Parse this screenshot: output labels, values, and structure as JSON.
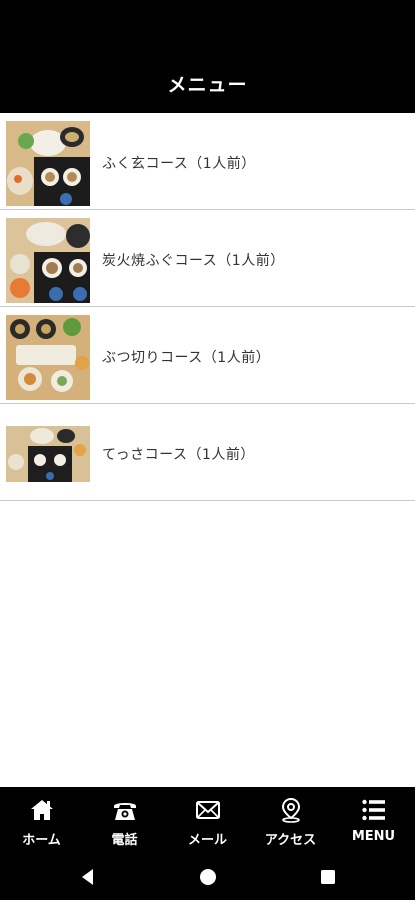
{
  "header": {
    "title": "メニュー"
  },
  "menu": {
    "items": [
      {
        "label": "ふく玄コース（1人前）",
        "image": "course-photo"
      },
      {
        "label": "炭火焼ふぐコース（1人前）",
        "image": "course-photo"
      },
      {
        "label": "ぶつ切りコース（1人前）",
        "image": "course-photo"
      },
      {
        "label": "てっさコース（1人前）",
        "image": "course-photo"
      }
    ]
  },
  "tabbar": {
    "items": [
      {
        "label": "ホーム",
        "icon": "home-icon"
      },
      {
        "label": "電話",
        "icon": "phone-icon"
      },
      {
        "label": "メール",
        "icon": "mail-icon"
      },
      {
        "label": "アクセス",
        "icon": "map-pin-icon"
      },
      {
        "label": "MENU",
        "icon": "hamburger-icon"
      }
    ]
  },
  "android_nav": {
    "icons": [
      "back-icon",
      "home-circle-icon",
      "recents-icon"
    ]
  },
  "colors": {
    "header_bg": "#000000",
    "tabbar_bg": "#000000",
    "text": "#333333",
    "divider": "#c8c8c8"
  }
}
